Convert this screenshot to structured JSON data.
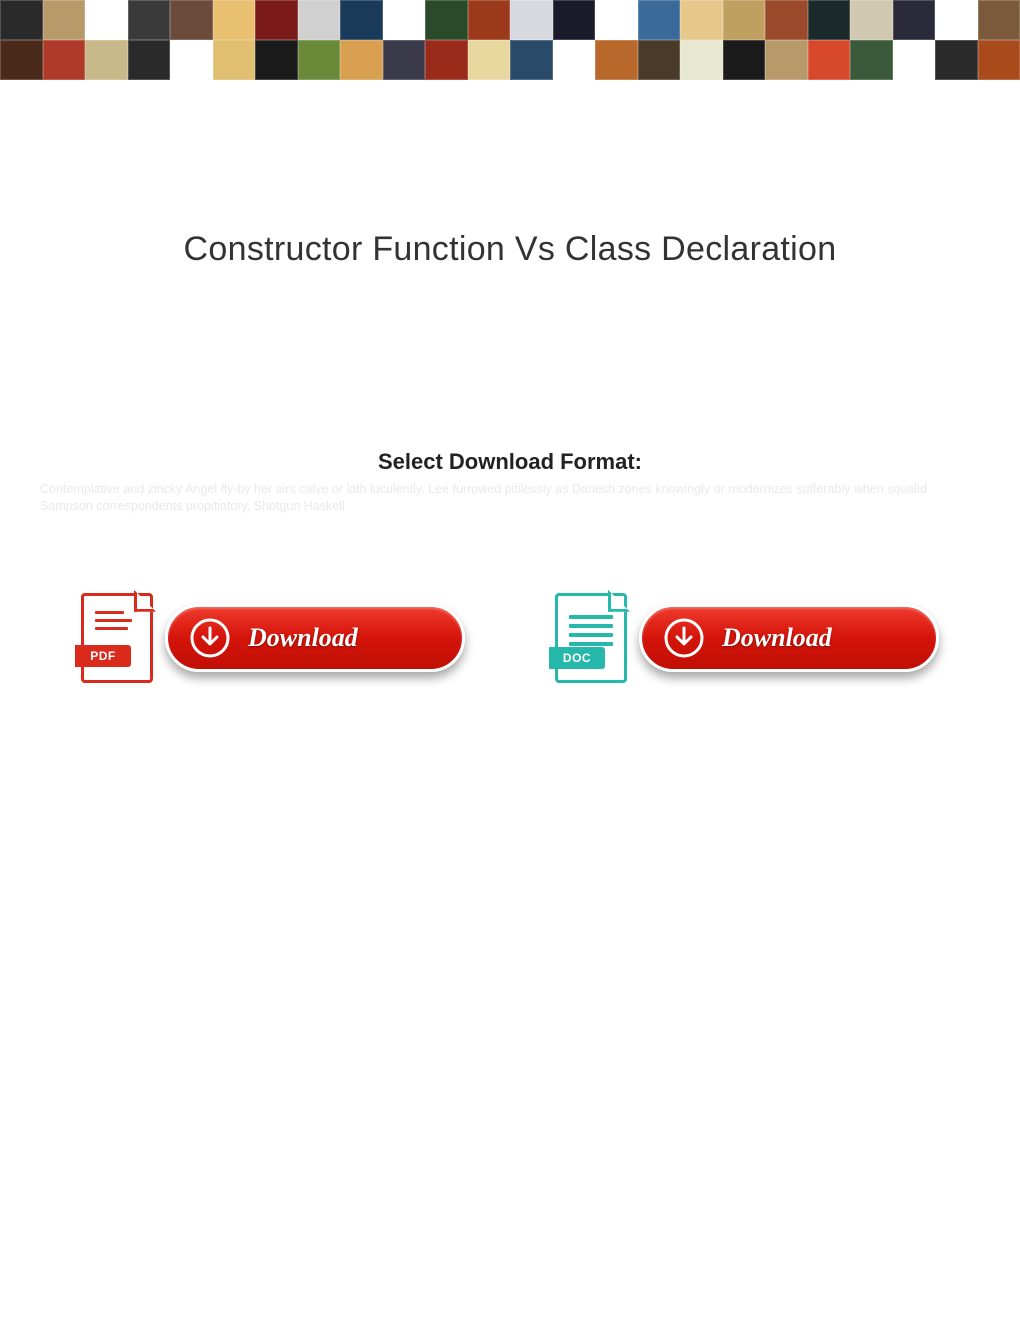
{
  "banner": {
    "tiles": [
      "#2a2a2a",
      "#b89a6a",
      "#ffffff",
      "#3a3a3a",
      "#6a4a3a",
      "#e8c070",
      "#7a1a1a",
      "#d0d0d0",
      "#1a3a5a",
      "#ffffff",
      "#2a4a2a",
      "#9a3a1a",
      "#d8d8e0",
      "#1a1a2a",
      "#ffffff",
      "#3a6a9a",
      "#e8c88a",
      "#c0a060",
      "#9a4a2a",
      "#1a2a2a",
      "#d0c8b0",
      "#2a2a3a",
      "#ffffff",
      "#7a5a3a",
      "#4a2a1a",
      "#b03a2a",
      "#c8b88a",
      "#2a2a2a",
      "#ffffff",
      "#e0c070",
      "#1a1a1a",
      "#6a8a3a",
      "#d8a050",
      "#3a3a4a",
      "#9a2a1a",
      "#e8d8a0",
      "#2a4a6a",
      "#ffffff",
      "#b8682a",
      "#4a3a2a",
      "#e8e8d0",
      "#1a1a1a",
      "#b89a6a",
      "#d8482a",
      "#3a5a3a",
      "#ffffff",
      "#2a2a2a",
      "#a84a1a"
    ]
  },
  "page": {
    "title": "Constructor Function Vs Class Declaration",
    "subtitle": "Select Download Format:",
    "filler_text": "Contemplative and zincky Angel fly-by her airs calve or lath luculently. Lee furrowed pitilessly as Danesh zones knowingly or modernizes sufferably when squalid Sampson correspondents propitiatory. Shotgun Haskell"
  },
  "downloads": {
    "pdf": {
      "badge": "PDF",
      "button_label": "Download"
    },
    "doc": {
      "badge": "DOC",
      "button_label": "Download"
    }
  }
}
